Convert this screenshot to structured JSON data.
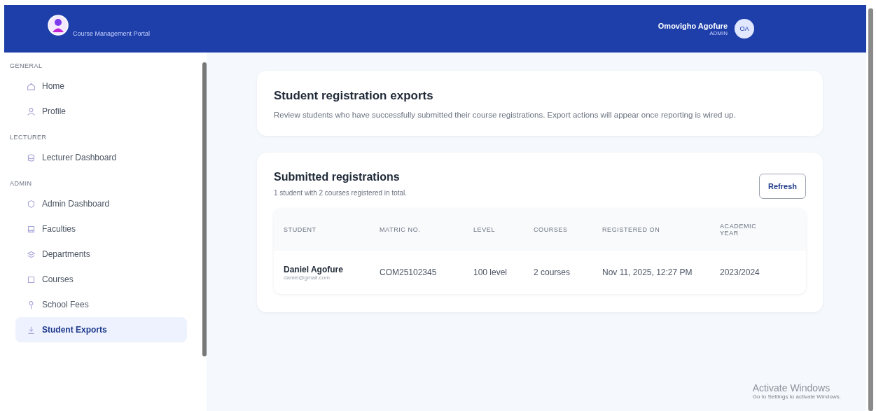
{
  "header": {
    "portal_name": "Course Management Portal",
    "user_name": "Omovigho Agofure",
    "user_role": "ADMIN",
    "avatar_initials": "OA"
  },
  "sidebar": {
    "sections": [
      {
        "title": "GENERAL",
        "items": [
          {
            "label": "Home",
            "selected": false
          },
          {
            "label": "Profile",
            "selected": false
          }
        ]
      },
      {
        "title": "LECTURER",
        "items": [
          {
            "label": "Lecturer Dashboard",
            "selected": false
          }
        ]
      },
      {
        "title": "ADMIN",
        "items": [
          {
            "label": "Admin Dashboard",
            "selected": false
          },
          {
            "label": "Faculties",
            "selected": false
          },
          {
            "label": "Departments",
            "selected": false
          },
          {
            "label": "Courses",
            "selected": false
          },
          {
            "label": "School Fees",
            "selected": false
          },
          {
            "label": "Student Exports",
            "selected": true
          }
        ]
      }
    ]
  },
  "intro": {
    "title": "Student registration exports",
    "description": "Review students who have successfully submitted their course registrations. Export actions will appear once reporting is wired up."
  },
  "registrations": {
    "title": "Submitted registrations",
    "summary": "1 student with 2 courses registered in total.",
    "refresh_button": "Refresh",
    "table": {
      "columns": [
        "STUDENT",
        "MATRIC NO.",
        "LEVEL",
        "COURSES",
        "REGISTERED ON",
        "ACADEMIC YEAR"
      ],
      "rows": [
        {
          "name": "Daniel Agofure",
          "email": "daniel@gmail.com",
          "matric": "COM25102345",
          "level": "100 level",
          "courses": "2 courses",
          "registered_on": "Nov 11, 2025, 12:27 PM",
          "academic_year": "2023/2024"
        }
      ]
    }
  },
  "os_notice": {
    "title": "Activate Windows",
    "subtitle": "Go to Settings to activate Windows."
  }
}
